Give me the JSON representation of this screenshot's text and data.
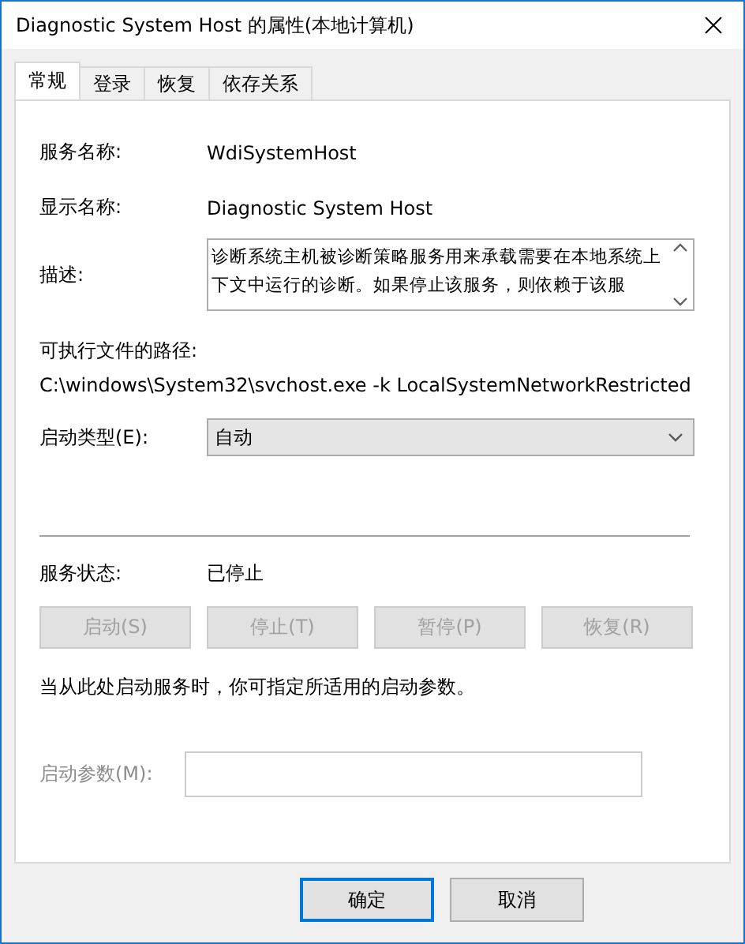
{
  "window": {
    "title": "Diagnostic System Host 的属性(本地计算机)"
  },
  "tabs": [
    {
      "label": "常规",
      "selected": true
    },
    {
      "label": "登录",
      "selected": false
    },
    {
      "label": "恢复",
      "selected": false
    },
    {
      "label": "依存关系",
      "selected": false
    }
  ],
  "service_name": {
    "label": "服务名称:",
    "value": "WdiSystemHost"
  },
  "display_name": {
    "label": "显示名称:",
    "value": "Diagnostic System Host"
  },
  "description": {
    "label": "描述:",
    "value": "诊断系统主机被诊断策略服务用来承载需要在本地系统上下文中运行的诊断。如果停止该服务，则依赖于该服"
  },
  "executable": {
    "label": "可执行文件的路径:",
    "value": "C:\\windows\\System32\\svchost.exe -k LocalSystemNetworkRestricted"
  },
  "startup_type": {
    "label": "启动类型(E):",
    "value": "自动"
  },
  "service_status": {
    "label": "服务状态:",
    "value": "已停止"
  },
  "control_buttons": [
    {
      "label": "启动(S)",
      "disabled": true
    },
    {
      "label": "停止(T)",
      "disabled": true
    },
    {
      "label": "暂停(P)",
      "disabled": true
    },
    {
      "label": "恢复(R)",
      "disabled": true
    }
  ],
  "hint": "当从此处启动服务时，你可指定所适用的启动参数。",
  "start_parameters": {
    "label": "启动参数(M):",
    "disabled": true
  },
  "dialog_buttons": [
    {
      "label": "确定",
      "default": true
    },
    {
      "label": "取消",
      "default": false
    }
  ]
}
